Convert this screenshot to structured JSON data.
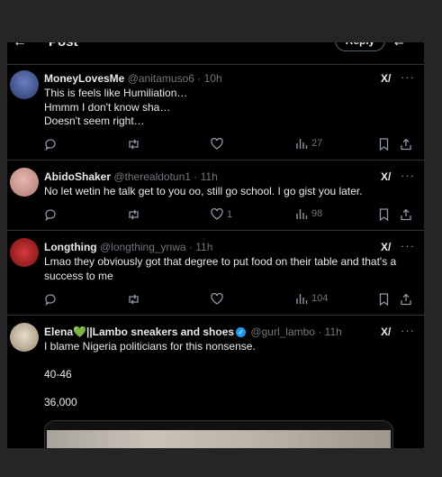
{
  "header": {
    "title": "Post",
    "reply_label": "Reply"
  },
  "tweets": [
    {
      "name": "MoneyLovesMe",
      "handle": "@anitamuso6",
      "time": "· 10h",
      "lines": [
        "This is feels like Humiliation…",
        "Hmmm I don't know sha…",
        "Doesn't seem right…"
      ],
      "replies": "",
      "reposts": "",
      "likes": "",
      "views": "27"
    },
    {
      "name": "AbidoShaker",
      "handle": "@therealdotun1",
      "time": "· 11h",
      "lines": [
        "No let wetin he talk get to you oo, still go school. I go gist you later."
      ],
      "replies": "",
      "reposts": "",
      "likes": "1",
      "views": "98"
    },
    {
      "name": "Longthing",
      "handle": "@longthing_ynwa",
      "time": "· 11h",
      "lines": [
        "Lmao they obviously got that degree to put food on their table and that's a success to me"
      ],
      "replies": "",
      "reposts": "",
      "likes": "",
      "views": "104"
    },
    {
      "name": "Elena💚||Lambo sneakers and shoes",
      "handle": "@gurl_lambo",
      "time": "· 11h",
      "lines": [
        "I blame Nigeria politicians for this nonsense.",
        "",
        "40-46",
        "",
        "36,000"
      ]
    }
  ],
  "colors": {
    "background": "#000000",
    "text": "#e7e9ea",
    "muted": "#71767b",
    "verified": "#1d9bf0"
  }
}
